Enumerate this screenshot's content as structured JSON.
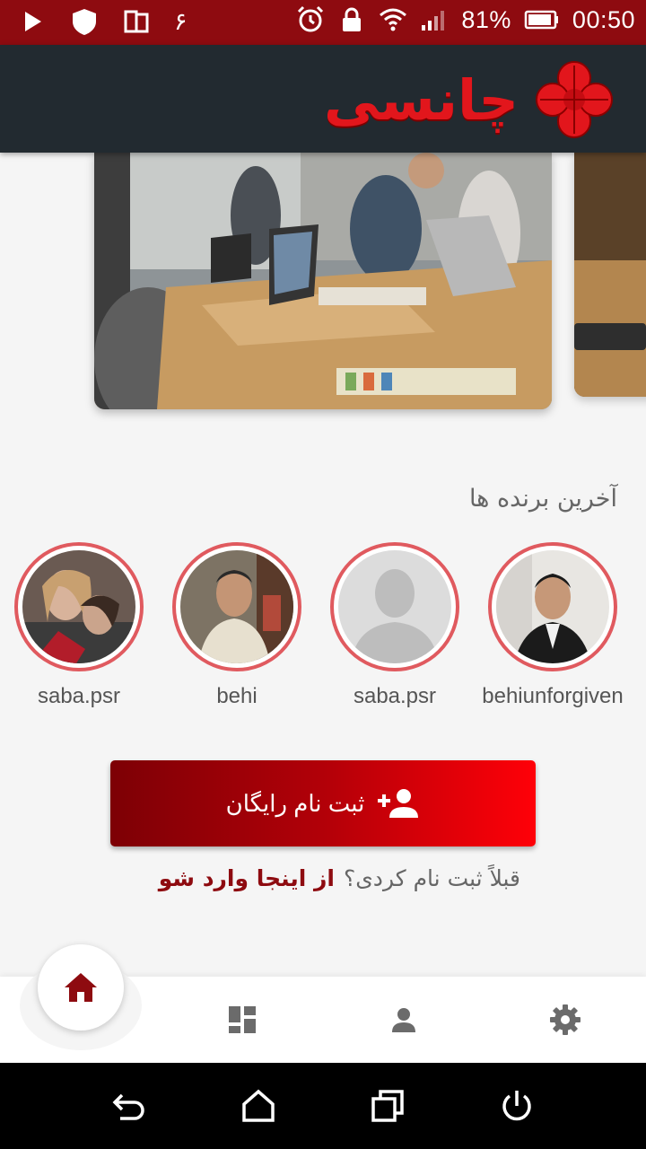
{
  "status_bar": {
    "left_icons": [
      "play-icon",
      "shield-icon",
      "sim-icon",
      "notification-digit"
    ],
    "notification_digit": "۶",
    "right_icons": [
      "alarm-icon",
      "lock-icon",
      "wifi-icon",
      "signal-icon",
      "battery-icon"
    ],
    "battery": "81%",
    "time": "00:50"
  },
  "header": {
    "logo_text": "چانسی",
    "logo_icon": "clover-icon",
    "brand_color": "#e2161c",
    "background": "#222a30"
  },
  "carousel": {
    "slides": [
      "meeting-photo",
      "desk-photo"
    ]
  },
  "winners": {
    "title": "آخرین برنده ها",
    "items": [
      {
        "name": "behiunforgiven",
        "avatar": "man-in-suit-photo"
      },
      {
        "name": "saba.psr",
        "avatar": "default-avatar-placeholder"
      },
      {
        "name": "behi",
        "avatar": "man-selfie-photo"
      },
      {
        "name": "saba.psr",
        "avatar": "two-women-photo"
      }
    ],
    "ring_color": "#e05a5f"
  },
  "register": {
    "button_label": "ثبت نام رایگان",
    "icon": "add-user-icon",
    "login_question": "قبلاً ثبت نام کردی؟",
    "login_link": "از اینجا وارد شو"
  },
  "bottom_nav": {
    "items": [
      {
        "name": "home",
        "icon": "home-icon",
        "active": true
      },
      {
        "name": "dashboard",
        "icon": "dashboard-icon",
        "active": false
      },
      {
        "name": "profile",
        "icon": "person-icon",
        "active": false
      },
      {
        "name": "settings",
        "icon": "gear-icon",
        "active": false
      }
    ],
    "active_color": "#8e0b10",
    "inactive_color": "#6b6b6b"
  },
  "android_nav": [
    "back-icon",
    "home-outline-icon",
    "recents-icon",
    "power-icon"
  ]
}
